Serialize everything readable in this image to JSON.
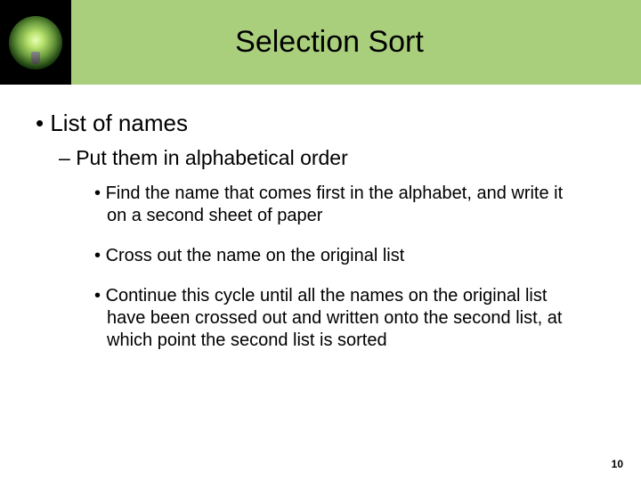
{
  "header": {
    "title": "Selection Sort",
    "icon": "lightbulb-icon"
  },
  "content": {
    "bullet1": "List of names",
    "sub1": "Put them in alphabetical order",
    "items": [
      "Find the name that comes first in the alphabet, and write it on a second sheet of paper",
      "Cross out the name on the original list",
      "Continue this cycle until all the names on the original list have been crossed out and written onto the second list, at which point the second list is sorted"
    ]
  },
  "page_number": "10"
}
